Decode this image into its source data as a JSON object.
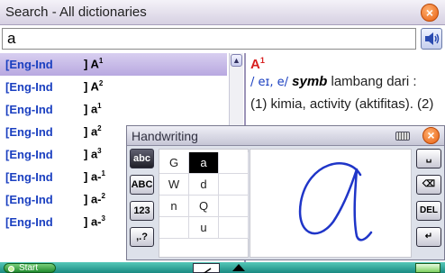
{
  "window": {
    "title": "Search - All dictionaries",
    "close_label": "×"
  },
  "search": {
    "value": "a"
  },
  "results": [
    {
      "dict": "[Eng-Ind",
      "entry": "] A",
      "sup": "1",
      "selected": true
    },
    {
      "dict": "[Eng-Ind",
      "entry": "] A",
      "sup": "2"
    },
    {
      "dict": "[Eng-Ind",
      "entry": "] a",
      "sup": "1"
    },
    {
      "dict": "[Eng-Ind",
      "entry": "] a",
      "sup": "2"
    },
    {
      "dict": "[Eng-Ind",
      "entry": "] a",
      "sup": "3"
    },
    {
      "dict": "[Eng-Ind",
      "entry": "] a-",
      "sup": "1"
    },
    {
      "dict": "[Eng-Ind",
      "entry": "] a-",
      "sup": "2"
    },
    {
      "dict": "[Eng-Ind",
      "entry": "] a-",
      "sup": "3"
    }
  ],
  "definition": {
    "headword": "A",
    "headword_sup": "1",
    "phonetic": "/ eɪ, e/",
    "pos": "symb",
    "line1_rest": " lambang dari :",
    "line2": "(1) kimia, activity (aktifitas). (2)"
  },
  "handwriting": {
    "title": "Handwriting",
    "close_label": "×",
    "modes": [
      "abc",
      "ABC",
      "123",
      ",.?"
    ],
    "candidates": [
      [
        "G",
        "a",
        ""
      ],
      [
        "W",
        "d",
        ""
      ],
      [
        "n",
        "Q",
        ""
      ],
      [
        "",
        "u",
        ""
      ]
    ],
    "selected_candidate": "a",
    "actions": [
      "␣",
      "⌫",
      "DEL",
      "↵"
    ]
  },
  "taskbar": {
    "start_label": "Start"
  },
  "labels": {
    "candidate_window": "Candidate window",
    "handwriting_area": "handwriting area"
  },
  "colors": {
    "dict_blue": "#1a3fc0",
    "headword_red": "#d82020",
    "ink_blue": "#1f35c8",
    "selected_row": "#b8a8e0"
  }
}
